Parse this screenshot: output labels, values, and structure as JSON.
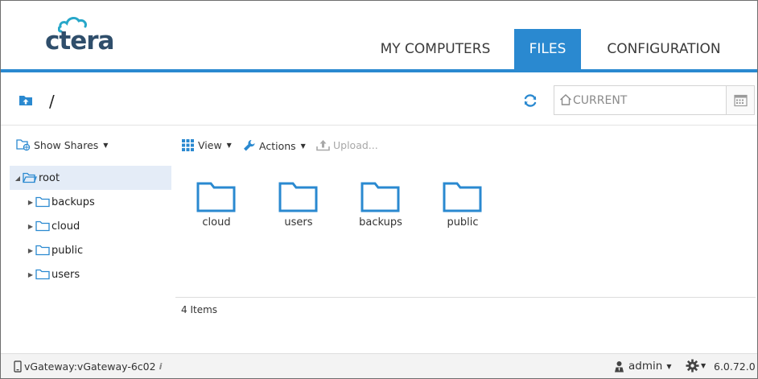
{
  "brand": {
    "logo_text": "ctera",
    "accent_color": "#2a89d0",
    "logo_color": "#2f4e6b"
  },
  "nav": {
    "tabs": [
      {
        "label": "MY COMPUTERS",
        "active": false
      },
      {
        "label": "FILES",
        "active": true
      },
      {
        "label": "CONFIGURATION",
        "active": false
      }
    ]
  },
  "pathbar": {
    "up_icon": "folder-up-icon",
    "path": "/",
    "refresh_icon": "refresh-icon",
    "snapshot": {
      "value": "CURRENT",
      "home_icon": "home-icon",
      "calendar_icon": "calendar-icon"
    }
  },
  "sidebar": {
    "show_shares_label": "Show Shares",
    "root_label": "root",
    "items": [
      {
        "label": "backups"
      },
      {
        "label": "cloud"
      },
      {
        "label": "public"
      },
      {
        "label": "users"
      }
    ]
  },
  "toolbar": {
    "view_label": "View",
    "actions_label": "Actions",
    "upload_label": "Upload..."
  },
  "files": [
    {
      "label": "cloud"
    },
    {
      "label": "users"
    },
    {
      "label": "backups"
    },
    {
      "label": "public"
    }
  ],
  "status": {
    "item_count": "4 Items"
  },
  "footer": {
    "gateway": "vGateway:vGateway-6c02",
    "user": "admin",
    "version": "6.0.72.0"
  }
}
